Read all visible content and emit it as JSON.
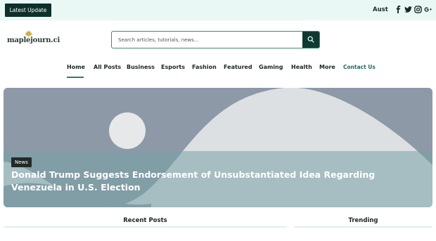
{
  "topbar": {
    "latest_label": "Latest Update",
    "ticker_text": "Aust",
    "social": [
      "facebook-icon",
      "twitter-icon",
      "instagram-icon",
      "google-plus-icon"
    ]
  },
  "logo": {
    "text": "maplejourn.ci"
  },
  "search": {
    "placeholder": "Search articles, tutorials, news..."
  },
  "nav": {
    "items": [
      "Home",
      "All Posts",
      "Business",
      "Esports",
      "Fashion",
      "Featured",
      "Gaming",
      "Health",
      "More",
      "Contact Us"
    ],
    "active": "Home"
  },
  "hero": {
    "badge": "News",
    "title": "Donald Trump Suggests Endorsement of Unsubstantiated Idea Regarding Venezuela in U.S. Election"
  },
  "sections": {
    "recent": "Recent Posts",
    "trending": "Trending"
  },
  "colors": {
    "accent": "#0e3a33",
    "topbar_bg": "#eaf8f5",
    "active_underline": "#2f7d70"
  }
}
